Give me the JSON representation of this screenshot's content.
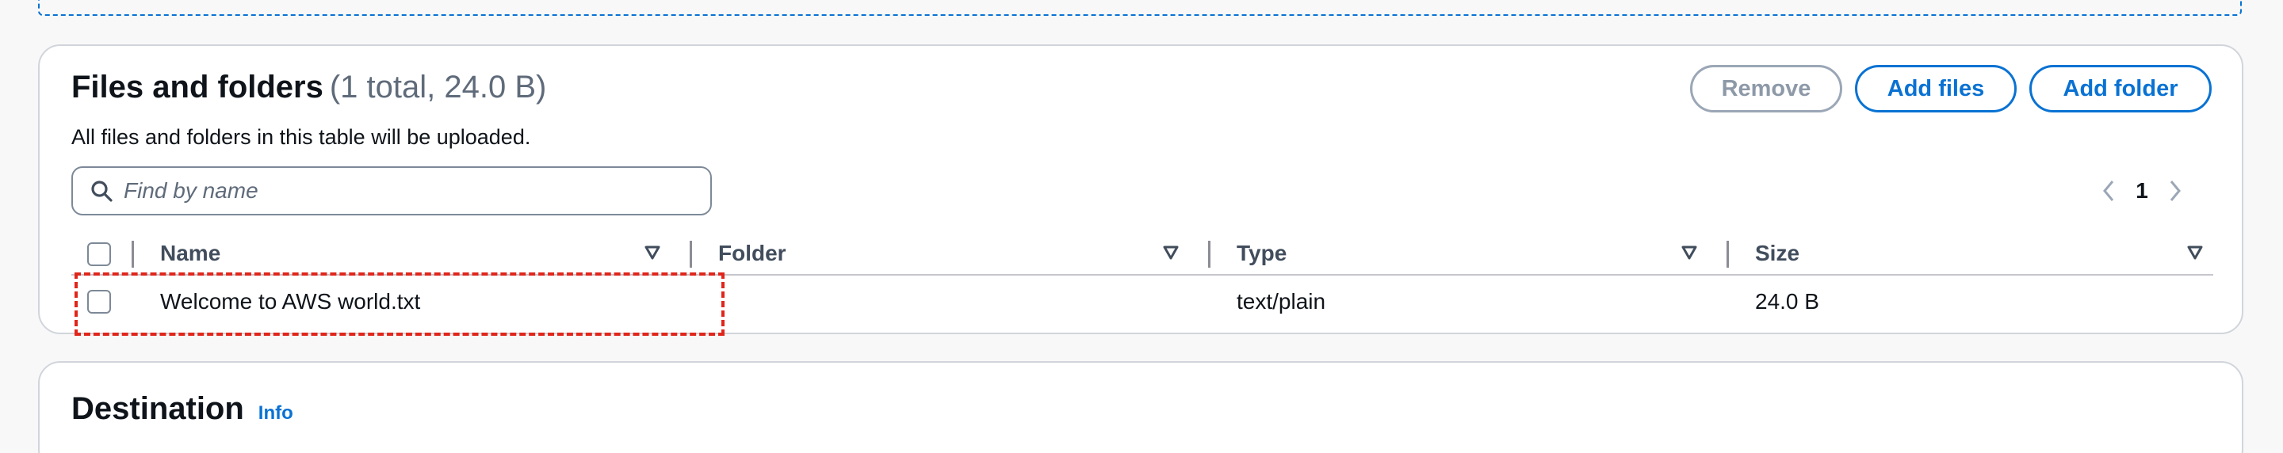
{
  "files_panel": {
    "title": "Files and folders",
    "counter": "(1 total, 24.0 B)",
    "description": "All files and folders in this table will be uploaded.",
    "buttons": {
      "remove": "Remove",
      "add_files": "Add files",
      "add_folder": "Add folder"
    },
    "search": {
      "placeholder": "Find by name",
      "value": ""
    },
    "pagination": {
      "current_page": "1"
    },
    "columns": [
      "Name",
      "Folder",
      "Type",
      "Size"
    ],
    "rows": [
      {
        "name": "Welcome to AWS world.txt",
        "folder": "",
        "type": "text/plain",
        "size": "24.0 B",
        "selected": false
      }
    ]
  },
  "destination_panel": {
    "title": "Destination",
    "info_link": "Info"
  },
  "colors": {
    "accent": "#0972d3",
    "highlight": "#e0251b",
    "disabled": "#8d99a8"
  },
  "icons": {
    "search": "search-icon",
    "prev": "chevron-left-icon",
    "next": "chevron-right-icon",
    "sort": "sort-triangle-icon"
  }
}
